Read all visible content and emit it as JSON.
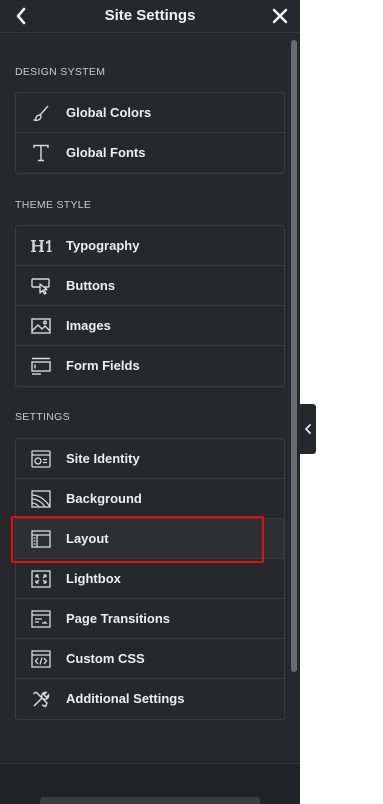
{
  "header": {
    "title": "Site Settings"
  },
  "sections": [
    {
      "title": "DESIGN SYSTEM",
      "items": [
        {
          "label": "Global Colors",
          "icon": "paint-brush-icon"
        },
        {
          "label": "Global Fonts",
          "icon": "text-t-icon"
        }
      ]
    },
    {
      "title": "THEME STYLE",
      "items": [
        {
          "label": "Typography",
          "icon": "heading-h1-icon"
        },
        {
          "label": "Buttons",
          "icon": "button-cursor-icon"
        },
        {
          "label": "Images",
          "icon": "image-icon"
        },
        {
          "label": "Form Fields",
          "icon": "form-field-icon"
        }
      ]
    },
    {
      "title": "SETTINGS",
      "items": [
        {
          "label": "Site Identity",
          "icon": "site-identity-icon"
        },
        {
          "label": "Background",
          "icon": "background-icon"
        },
        {
          "label": "Layout",
          "icon": "layout-icon"
        },
        {
          "label": "Lightbox",
          "icon": "lightbox-icon"
        },
        {
          "label": "Page Transitions",
          "icon": "page-transitions-icon"
        },
        {
          "label": "Custom CSS",
          "icon": "code-icon"
        },
        {
          "label": "Additional Settings",
          "icon": "tools-icon"
        }
      ]
    }
  ],
  "colors": {
    "panel_bg": "#27282c",
    "highlight_border": "#e01212",
    "text": "#eeeef0"
  }
}
